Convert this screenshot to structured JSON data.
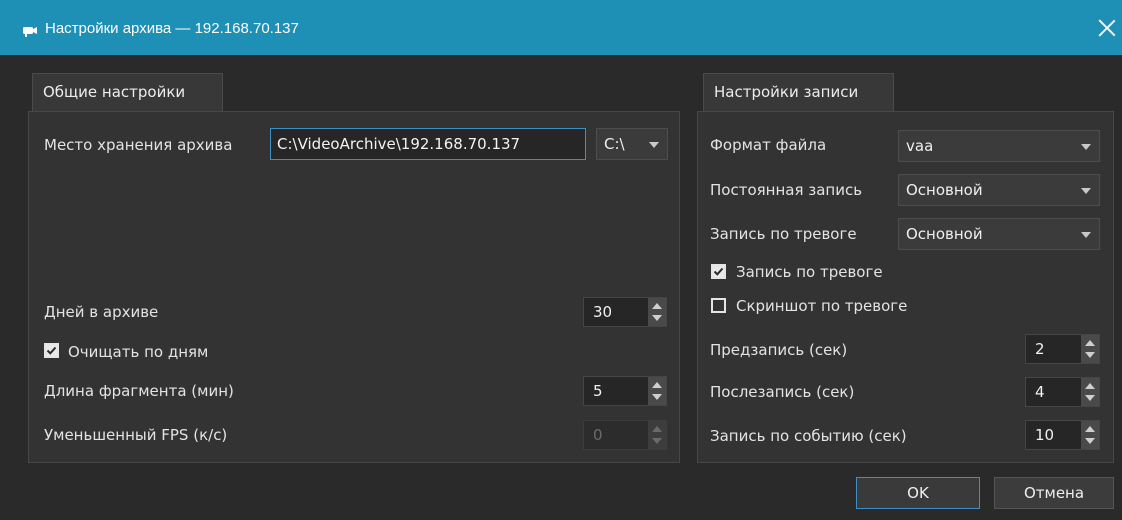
{
  "window": {
    "title": "Настройки архива — 192.168.70.137",
    "icon": "camera-icon",
    "titlebar_color": "#1e8fb5"
  },
  "general": {
    "tab_label": "Общие настройки",
    "storage_label": "Место хранения архива",
    "storage_path": "C:\\VideoArchive\\192.168.70.137",
    "drive": "C:\\",
    "days_label": "Дней в архиве",
    "days_value": "30",
    "clear_by_days_label": "Очищать по дням",
    "clear_by_days_checked": true,
    "fragment_label": "Длина фрагмента (мин)",
    "fragment_value": "5",
    "reduced_fps_label": "Уменьшенный FPS (к/с)",
    "reduced_fps_value": "0",
    "reduced_fps_enabled": false
  },
  "recording": {
    "tab_label": "Настройки записи",
    "file_format_label": "Формат файла",
    "file_format_value": "vaa",
    "constant_label": "Постоянная запись",
    "constant_value": "Основной",
    "alarm_stream_label": "Запись по тревоге",
    "alarm_stream_value": "Основной",
    "alarm_rec_checkbox_label": "Запись по тревоге",
    "alarm_rec_checked": true,
    "screenshot_label": "Скриншот по тревоге",
    "screenshot_checked": false,
    "pre_label": "Предзапись (сек)",
    "pre_value": "2",
    "post_label": "Послезапись (сек)",
    "post_value": "4",
    "event_label": "Запись по событию (сек)",
    "event_value": "10"
  },
  "footer": {
    "ok_label": "OK",
    "cancel_label": "Отмена"
  }
}
